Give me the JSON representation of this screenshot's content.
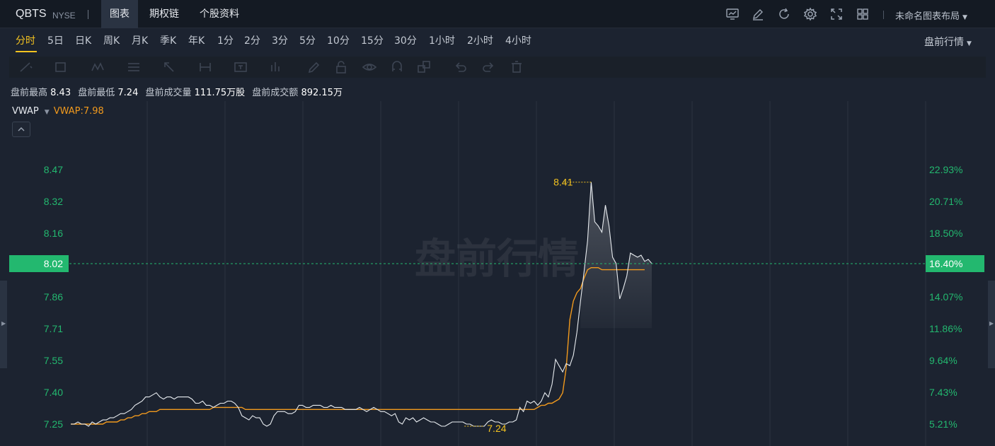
{
  "header": {
    "ticker": "QBTS",
    "exchange": "NYSE",
    "tabs": [
      {
        "label": "图表",
        "active": true
      },
      {
        "label": "期权链",
        "active": false
      },
      {
        "label": "个股资料",
        "active": false
      }
    ],
    "icons": [
      "indicators-icon",
      "edit-pen-icon",
      "refresh-icon",
      "settings-gear-icon",
      "fullscreen-icon",
      "grid-layout-icon"
    ],
    "layout_name": "未命名图表布局"
  },
  "periods": [
    {
      "label": "分时",
      "active": true
    },
    {
      "label": "5日"
    },
    {
      "label": "日K"
    },
    {
      "label": "周K"
    },
    {
      "label": "月K"
    },
    {
      "label": "季K"
    },
    {
      "label": "年K"
    },
    {
      "label": "1分"
    },
    {
      "label": "2分"
    },
    {
      "label": "3分"
    },
    {
      "label": "5分"
    },
    {
      "label": "10分"
    },
    {
      "label": "15分"
    },
    {
      "label": "30分"
    },
    {
      "label": "1小时"
    },
    {
      "label": "2小时"
    },
    {
      "label": "4小时"
    }
  ],
  "session_dropdown": "盘前行情",
  "draw_tools": [
    "trend-line-icon",
    "rectangle-icon",
    "pattern-icon",
    "fib-icon",
    "arrow-icon",
    "measure-icon",
    "text-icon",
    "bar-icon",
    "pencil-icon",
    "lock-icon",
    "eye-icon",
    "magnet-icon",
    "clone-icon",
    "undo-icon",
    "redo-icon",
    "trash-icon"
  ],
  "info": {
    "high_label": "盘前最高",
    "high": "8.43",
    "low_label": "盘前最低",
    "low": "7.24",
    "volume_label": "盘前成交量",
    "volume": "111.75万股",
    "turnover_label": "盘前成交额",
    "turnover": "892.15万"
  },
  "legend": {
    "name": "VWAP",
    "value_text": "VWAP:7.98"
  },
  "colors": {
    "up": "#23b86f",
    "vwap": "#f29a1d",
    "price": "#e8ecf0",
    "marker": "#f4c320",
    "bg": "#1c2330"
  },
  "chart_data": {
    "type": "line",
    "watermark": "盘前行情",
    "y_left_ticks": [
      "8.47",
      "8.32",
      "8.16",
      "8.02",
      "7.86",
      "7.71",
      "7.55",
      "7.40",
      "7.25"
    ],
    "y_right_ticks": [
      "22.93%",
      "20.71%",
      "18.50%",
      "16.40%",
      "14.07%",
      "11.86%",
      "9.64%",
      "7.43%",
      "5.21%"
    ],
    "current_price": "8.02",
    "current_pct": "16.40%",
    "max_label": "8.41",
    "min_label": "7.24",
    "ylim": [
      7.22,
      8.5
    ],
    "series": [
      {
        "name": "price",
        "values": [
          7.25,
          7.25,
          7.26,
          7.25,
          7.25,
          7.24,
          7.26,
          7.25,
          7.26,
          7.27,
          7.27,
          7.28,
          7.28,
          7.29,
          7.3,
          7.3,
          7.31,
          7.32,
          7.34,
          7.35,
          7.36,
          7.38,
          7.38,
          7.39,
          7.4,
          7.38,
          7.37,
          7.38,
          7.38,
          7.37,
          7.38,
          7.38,
          7.38,
          7.38,
          7.37,
          7.35,
          7.35,
          7.36,
          7.34,
          7.34,
          7.33,
          7.34,
          7.35,
          7.35,
          7.36,
          7.36,
          7.35,
          7.33,
          7.29,
          7.28,
          7.27,
          7.29,
          7.28,
          7.28,
          7.25,
          7.24,
          7.25,
          7.29,
          7.31,
          7.31,
          7.31,
          7.3,
          7.3,
          7.31,
          7.34,
          7.34,
          7.33,
          7.33,
          7.34,
          7.34,
          7.34,
          7.33,
          7.33,
          7.34,
          7.33,
          7.33,
          7.33,
          7.32,
          7.32,
          7.32,
          7.32,
          7.33,
          7.32,
          7.31,
          7.32,
          7.33,
          7.32,
          7.31,
          7.31,
          7.3,
          7.29,
          7.3,
          7.26,
          7.25,
          7.28,
          7.27,
          7.28,
          7.26,
          7.27,
          7.28,
          7.27,
          7.26,
          7.26,
          7.25,
          7.24,
          7.24,
          7.25,
          7.26,
          7.26,
          7.26,
          7.26,
          7.25,
          7.25,
          7.24,
          7.24,
          7.24,
          7.24,
          7.26,
          7.27,
          7.26,
          7.26,
          7.25,
          7.25,
          7.26,
          7.26,
          7.27,
          7.33,
          7.31,
          7.36,
          7.35,
          7.36,
          7.34,
          7.36,
          7.4,
          7.38,
          7.44,
          7.56,
          7.53,
          7.5,
          7.54,
          7.53,
          7.58,
          7.69,
          7.84,
          7.98,
          8.13,
          8.41,
          8.22,
          8.2,
          8.17,
          8.3,
          8.2,
          8.05,
          8.02,
          7.85,
          7.9,
          7.96,
          8.07,
          8.06,
          8.05,
          8.06,
          8.03,
          8.04,
          8.02
        ]
      },
      {
        "name": "VWAP",
        "values": [
          7.25,
          7.25,
          7.25,
          7.25,
          7.25,
          7.25,
          7.25,
          7.25,
          7.25,
          7.25,
          7.26,
          7.26,
          7.26,
          7.26,
          7.27,
          7.27,
          7.28,
          7.28,
          7.29,
          7.29,
          7.3,
          7.3,
          7.31,
          7.31,
          7.31,
          7.32,
          7.32,
          7.32,
          7.32,
          7.32,
          7.32,
          7.32,
          7.32,
          7.32,
          7.32,
          7.32,
          7.32,
          7.32,
          7.32,
          7.32,
          7.33,
          7.33,
          7.33,
          7.33,
          7.33,
          7.33,
          7.33,
          7.33,
          7.33,
          7.32,
          7.32,
          7.32,
          7.32,
          7.32,
          7.32,
          7.32,
          7.32,
          7.32,
          7.32,
          7.32,
          7.32,
          7.32,
          7.32,
          7.32,
          7.32,
          7.32,
          7.32,
          7.32,
          7.32,
          7.32,
          7.32,
          7.32,
          7.32,
          7.32,
          7.32,
          7.32,
          7.32,
          7.32,
          7.32,
          7.32,
          7.32,
          7.32,
          7.32,
          7.32,
          7.32,
          7.32,
          7.32,
          7.32,
          7.32,
          7.32,
          7.32,
          7.32,
          7.32,
          7.32,
          7.32,
          7.32,
          7.32,
          7.32,
          7.32,
          7.32,
          7.32,
          7.32,
          7.32,
          7.32,
          7.32,
          7.32,
          7.32,
          7.32,
          7.32,
          7.32,
          7.32,
          7.32,
          7.32,
          7.32,
          7.32,
          7.32,
          7.32,
          7.32,
          7.32,
          7.32,
          7.32,
          7.32,
          7.32,
          7.32,
          7.32,
          7.32,
          7.32,
          7.32,
          7.32,
          7.32,
          7.32,
          7.33,
          7.34,
          7.34,
          7.35,
          7.35,
          7.36,
          7.37,
          7.4,
          7.52,
          7.75,
          7.84,
          7.88,
          7.9,
          7.95,
          7.99,
          8.0,
          8.0,
          8.0,
          7.99,
          7.99,
          7.99,
          7.99,
          7.99,
          7.99,
          7.99,
          7.99,
          7.99,
          7.99,
          7.99,
          7.99,
          7.99
        ]
      }
    ]
  }
}
